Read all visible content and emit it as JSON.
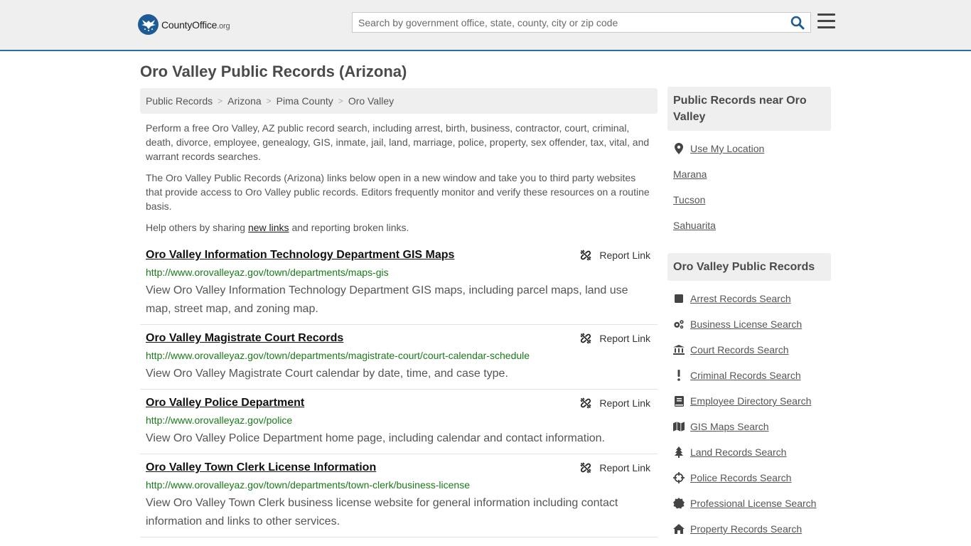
{
  "header": {
    "logo_text": "CountyOffice",
    "logo_suffix": ".org",
    "search_placeholder": "Search by government office, state, county, city or zip code"
  },
  "page_title": "Oro Valley Public Records (Arizona)",
  "breadcrumb": [
    "Public Records",
    "Arizona",
    "Pima County",
    "Oro Valley"
  ],
  "intro": {
    "p1": "Perform a free Oro Valley, AZ public record search, including arrest, birth, business, contractor, court, criminal, death, divorce, employee, genealogy, GIS, inmate, jail, land, marriage, police, property, sex offender, tax, vital, and warrant records searches.",
    "p2": "The Oro Valley Public Records (Arizona) links below open in a new window and take you to third party websites that provide access to Oro Valley public records. Editors frequently monitor and verify these resources on a routine basis.",
    "p3_before": "Help others by sharing ",
    "p3_link": "new links",
    "p3_after": " and reporting broken links."
  },
  "report_label": "Report Link",
  "records": [
    {
      "title": "Oro Valley Information Technology Department GIS Maps",
      "url": "http://www.orovalleyaz.gov/town/departments/maps-gis",
      "desc": "View Oro Valley Information Technology Department GIS maps, including parcel maps, land use map, street map, and zoning map."
    },
    {
      "title": "Oro Valley Magistrate Court Records",
      "url": "http://www.orovalleyaz.gov/town/departments/magistrate-court/court-calendar-schedule",
      "desc": "View Oro Valley Magistrate Court calendar by date, time, and case type."
    },
    {
      "title": "Oro Valley Police Department",
      "url": "http://www.orovalleyaz.gov/police",
      "desc": "View Oro Valley Police Department home page, including calendar and contact information."
    },
    {
      "title": "Oro Valley Town Clerk License Information",
      "url": "http://www.orovalleyaz.gov/town/departments/town-clerk/business-license",
      "desc": "View Oro Valley Town Clerk business license website for general information including contact information and links to other services."
    }
  ],
  "sidebar": {
    "near_heading": "Public Records near Oro Valley",
    "near_links": [
      "Use My Location",
      "Marana",
      "Tucson",
      "Sahuarita"
    ],
    "records_heading": "Oro Valley Public Records",
    "record_links": [
      {
        "label": "Arrest Records Search",
        "icon": "square-icon"
      },
      {
        "label": "Business License Search",
        "icon": "gears-icon"
      },
      {
        "label": "Court Records Search",
        "icon": "courthouse-icon"
      },
      {
        "label": "Criminal Records Search",
        "icon": "exclamation-icon"
      },
      {
        "label": "Employee Directory Search",
        "icon": "book-icon"
      },
      {
        "label": "GIS Maps Search",
        "icon": "map-icon"
      },
      {
        "label": "Land Records Search",
        "icon": "tree-icon"
      },
      {
        "label": "Police Records Search",
        "icon": "crosshair-icon"
      },
      {
        "label": "Professional License Search",
        "icon": "certificate-icon"
      },
      {
        "label": "Property Records Search",
        "icon": "home-icon"
      }
    ]
  },
  "colors": {
    "accent": "#2a6fb0",
    "link_url": "#1b7a1b",
    "header_bg": "#efefef"
  }
}
